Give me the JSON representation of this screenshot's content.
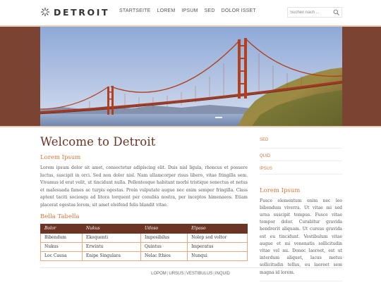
{
  "header": {
    "logo_text": "DETROIT",
    "nav": [
      "STARTSEITE",
      "LOREM",
      "IPSUM",
      "SED",
      "DOLOR ISSET"
    ],
    "search_placeholder": "Suchen nach ..."
  },
  "main": {
    "title": "Welcome to Detroit",
    "section_title": "Lorem Ipsum",
    "intro": "Lorem ipsum dolor sit amet, consectetur adipiscing elit. Duis nisl ligula, rhoncus et posuere luctus, suscipit in orci. Sed non dolor nisl. Nam ullamcorper risus libero, vitae fringilla sem. Vivamus id erat velit, ut tincidunt nulla. Pellentesque habitant morbi tristique senectus et netus et malesuada fames ac turpis egestas. Proin vulputate augue nec enim semper fringilla. Class aptent taciti sociosqu ad litora torquent per conubia nostra, per inceptos himenaeos. Etiam placerat egestas lorem, sit amet eleifend felis blandit vitae.",
    "table_title": "Bella Tabella",
    "table": {
      "headers": [
        "Bolor",
        "Nukus",
        "Udoso",
        "Elpaso"
      ],
      "rows": [
        [
          "Bibendum",
          "Ekoquenti",
          "Imposibilus",
          "Nolep sed voltor"
        ],
        [
          "Nukus",
          "Erwintu",
          "Quintus",
          "Imperatus"
        ],
        [
          "Loc Causa",
          "Enipe Singulara",
          "Nelac Ithios",
          "Nunqui"
        ]
      ]
    }
  },
  "sidebar": {
    "links": [
      "SED",
      "QUID",
      "IPSUS"
    ],
    "title": "Lorem Ipsum",
    "text": "Fusce elementum enim nec leo bibendum viverra. Ut vitae mi sed urna suscipit tempus. Fusce vitae tempor dolor. Curabitur gravida hendrerit aliquam. Ut cursus gravida est eu tincidunt. Vestibulum vitae augue et mi venenatis sollicitudin vitae vel mi. Donec laoreet, est ut interdum aliquet, lacus metus sollicitudin tellus, eu laoreet sem magna id lorem."
  },
  "footer": {
    "links": [
      "LOPOM",
      "URSUS",
      "VESTIBULUS",
      "INQUID"
    ],
    "separator": "|"
  },
  "colors": {
    "brand_brown": "#6b3424",
    "band_brown": "#7a4332",
    "accent_orange": "#d6783b",
    "table_border": "#e2a983"
  },
  "icons": {
    "logo": "sunburst-logo-icon",
    "search": "search-icon"
  }
}
